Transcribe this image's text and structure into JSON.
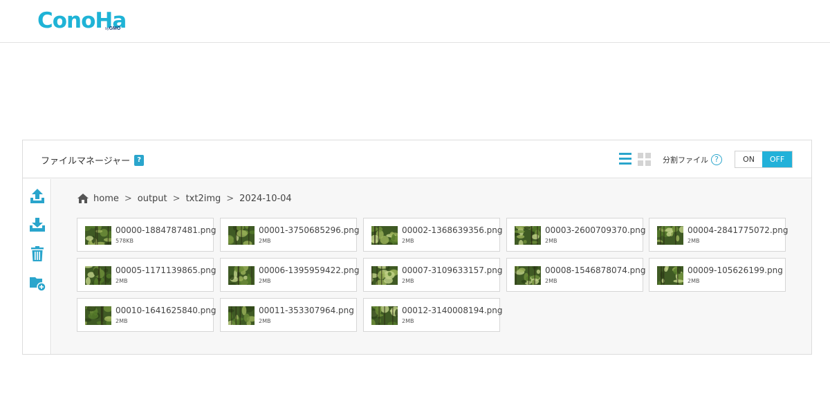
{
  "brand": {
    "logo_text": "ConoHa",
    "logo_by": "by",
    "logo_sub": "GMO",
    "color": "#1fb3d6"
  },
  "panel": {
    "title": "ファイルマネージャー",
    "title_help": "?",
    "split_label": "分割ファイル",
    "split_help": "?",
    "toggle_on": "ON",
    "toggle_off": "OFF",
    "toggle_state": "OFF",
    "accent": "#22b1d9"
  },
  "sidebar": {
    "items": [
      {
        "name": "upload-icon"
      },
      {
        "name": "download-icon"
      },
      {
        "name": "trash-icon"
      },
      {
        "name": "new-folder-icon"
      }
    ]
  },
  "breadcrumb": {
    "items": [
      "home",
      "output",
      "txt2img",
      "2024-10-04"
    ],
    "separator": ">"
  },
  "files": [
    {
      "name": "00000-1884787481.png",
      "size": "578KB"
    },
    {
      "name": "00001-3750685296.png",
      "size": "2MB"
    },
    {
      "name": "00002-1368639356.png",
      "size": "2MB"
    },
    {
      "name": "00003-2600709370.png",
      "size": "2MB"
    },
    {
      "name": "00004-2841775072.png",
      "size": "2MB"
    },
    {
      "name": "00005-1171139865.png",
      "size": "2MB"
    },
    {
      "name": "00006-1395959422.png",
      "size": "2MB"
    },
    {
      "name": "00007-3109633157.png",
      "size": "2MB"
    },
    {
      "name": "00008-1546878074.png",
      "size": "2MB"
    },
    {
      "name": "00009-105626199.png",
      "size": "2MB"
    },
    {
      "name": "00010-1641625840.png",
      "size": "2MB"
    },
    {
      "name": "00011-353307964.png",
      "size": "2MB"
    },
    {
      "name": "00012-3140008194.png",
      "size": "2MB"
    }
  ]
}
